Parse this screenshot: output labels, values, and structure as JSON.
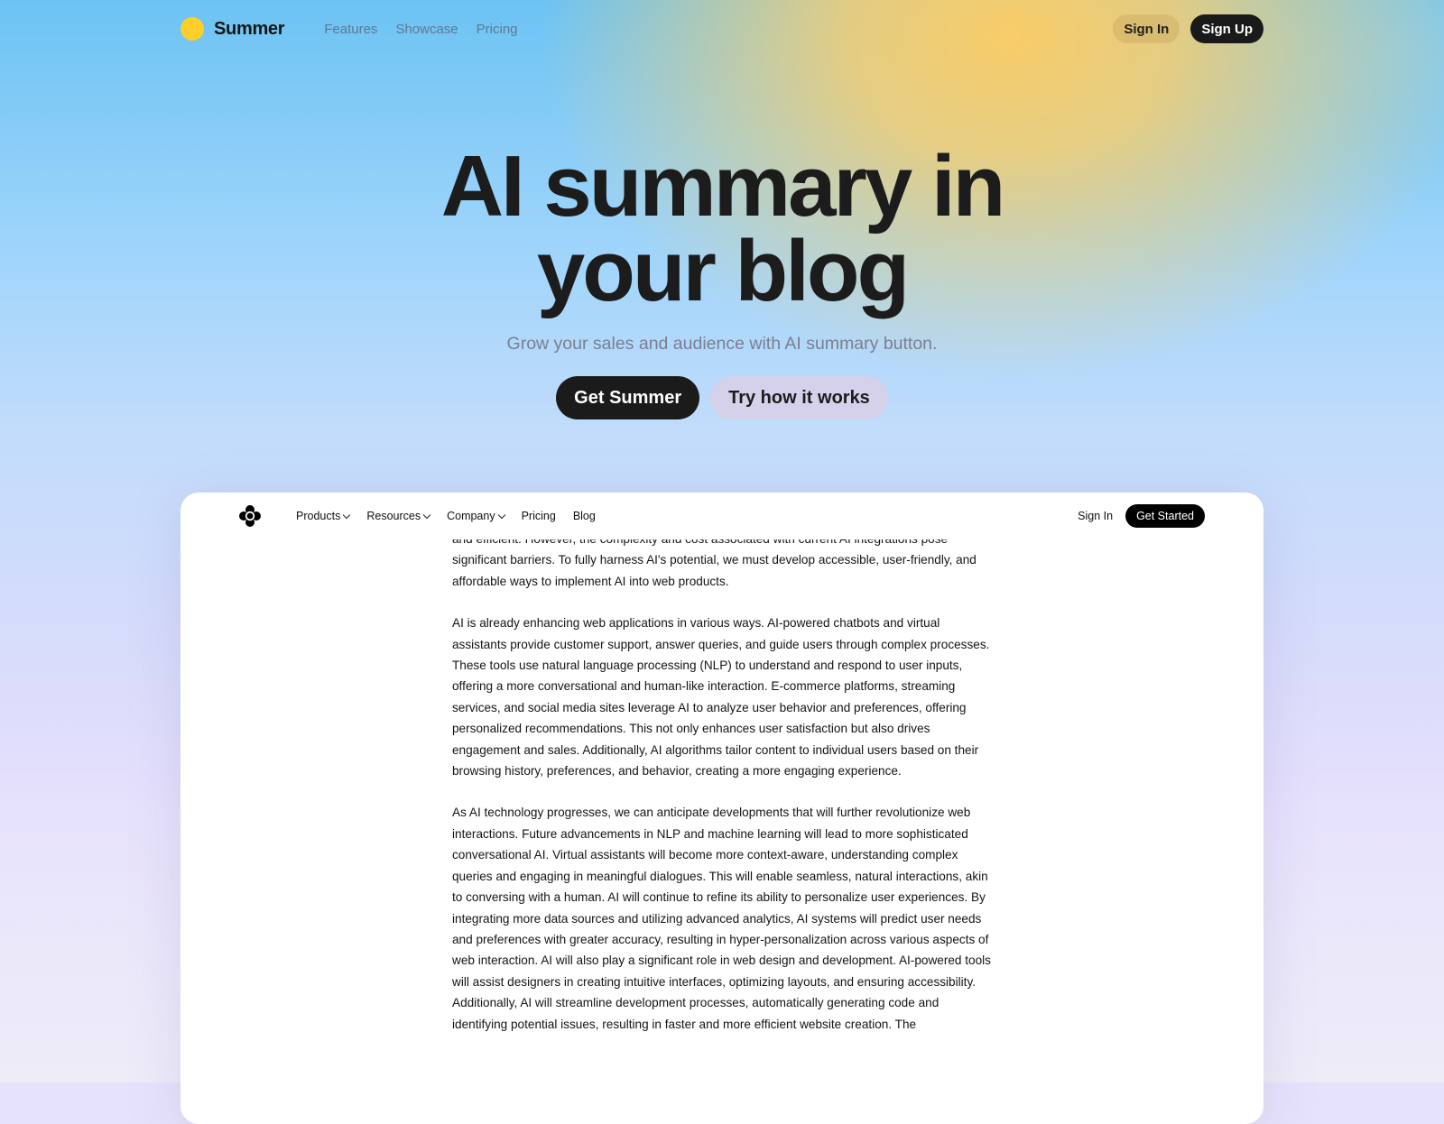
{
  "nav": {
    "brand": "Summer",
    "links": [
      "Features",
      "Showcase",
      "Pricing"
    ],
    "sign_in": "Sign In",
    "sign_up": "Sign Up"
  },
  "hero": {
    "title_line1": "AI summary in",
    "title_line2": "your blog",
    "subtitle": "Grow your sales and audience with AI summary button.",
    "primary_cta": "Get Summer",
    "secondary_cta": "Try how it works"
  },
  "preview": {
    "nav": {
      "logo_icon": "flower-logo-icon",
      "items": [
        {
          "label": "Products",
          "has_dropdown": true
        },
        {
          "label": "Resources",
          "has_dropdown": true
        },
        {
          "label": "Company",
          "has_dropdown": true
        },
        {
          "label": "Pricing",
          "has_dropdown": false
        },
        {
          "label": "Blog",
          "has_dropdown": false
        }
      ],
      "sign_in": "Sign In",
      "get_started": "Get Started"
    },
    "paragraphs": [
      "and efficient. However, the complexity and cost associated with current AI integrations pose significant barriers. To fully harness AI's potential, we must develop accessible, user-friendly, and affordable ways to implement AI into web products.",
      "AI is already enhancing web applications in various ways. AI-powered chatbots and virtual assistants provide customer support, answer queries, and guide users through complex processes. These tools use natural language processing (NLP) to understand and respond to user inputs, offering a more conversational and human-like interaction. E-commerce platforms, streaming services, and social media sites leverage AI to analyze user behavior and preferences, offering personalized recommendations. This not only enhances user satisfaction but also drives engagement and sales. Additionally, AI algorithms tailor content to individual users based on their browsing history, preferences, and behavior, creating a more engaging experience.",
      "As AI technology progresses, we can anticipate developments that will further revolutionize web interactions. Future advancements in NLP and machine learning will lead to more sophisticated conversational AI. Virtual assistants will become more context-aware, understanding complex queries and engaging in meaningful dialogues. This will enable seamless, natural interactions, akin to conversing with a human. AI will continue to refine its ability to personalize user experiences. By integrating more data sources and utilizing advanced analytics, AI systems will predict user needs and preferences with greater accuracy, resulting in hyper-personalization across various aspects of web interaction. AI will also play a significant role in web design and development. AI-powered tools will assist designers in creating intuitive interfaces, optimizing layouts, and ensuring accessibility. Additionally, AI will streamline development processes, automatically generating code and identifying potential issues, resulting in faster and more efficient website creation. The"
    ]
  },
  "colors": {
    "logo_dot": "#fdcf2b",
    "dark_button": "#1a1a1a",
    "secondary_button": "#d5d1ea",
    "sky_blue": "#6cc3f3",
    "sun_yellow": "#f8cc68",
    "lavender": "#e7e2fb"
  }
}
